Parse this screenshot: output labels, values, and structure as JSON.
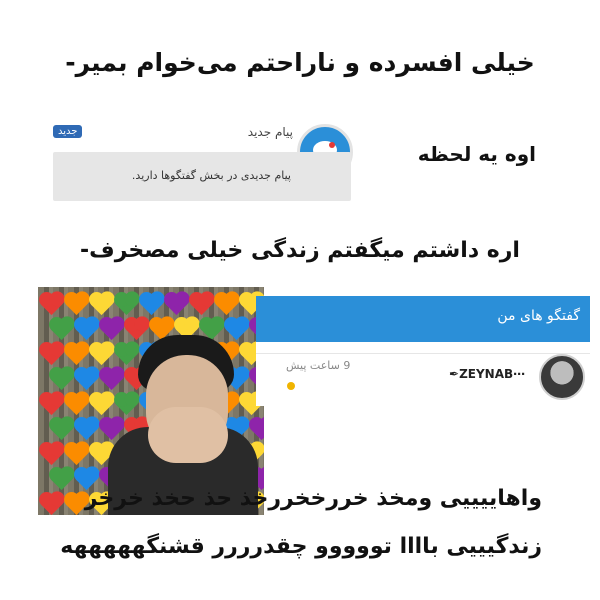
{
  "captions": {
    "line1": "خیلی افسرده و ناراحتم می‌خوام بمیر-",
    "line2": "اوه یه لحظه",
    "line3": "اره داشتم میگفتم زندگی خیلی مصخرف-",
    "line4": "واهاییییی ومخذ خررخخررخذ حذ حخذ خرخر",
    "line5": "زندگیییی باااا تووووو چقدرررر قشنگهههههه"
  },
  "notification": {
    "badge": "جدید",
    "title": "پیام جدید",
    "body": "پیام جدیدی در بخش گفتگوها دارید.",
    "icon": "chat-bubble-icon",
    "accent": "#2b8fd8"
  },
  "meme": {
    "heart_colors": [
      "#e53935",
      "#fb8c00",
      "#fdd835",
      "#43a047",
      "#1e88e5",
      "#8e24aa"
    ]
  },
  "chats": {
    "title": "گفتگو های من",
    "item": {
      "name": "ZEYNAB",
      "time": "9 ساعت پیش",
      "status_color": "#f0b400"
    }
  }
}
